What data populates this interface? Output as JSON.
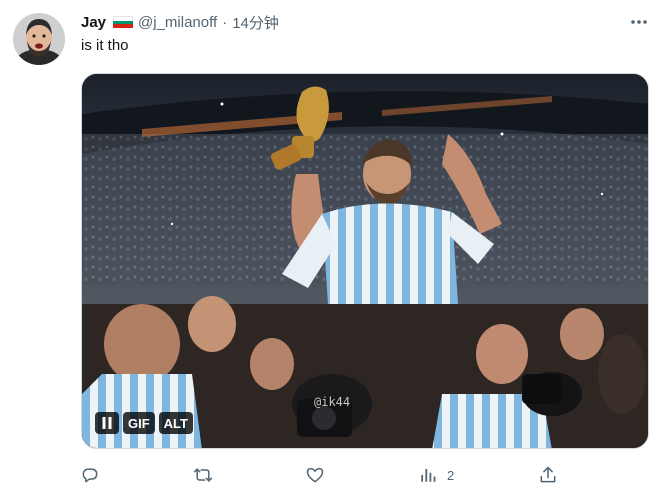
{
  "tweet": {
    "display_name": "Jay",
    "handle": "@j_milanoff",
    "separator": "·",
    "time": "14分钟",
    "text": "is it tho"
  },
  "media": {
    "watermark": "@ik44",
    "gif_badge": "GIF",
    "alt_badge": "ALT"
  },
  "actions": {
    "views_count": "2"
  },
  "icons": {
    "more": "more-icon",
    "reply": "reply-icon",
    "retweet": "retweet-icon",
    "like": "heart-icon",
    "views": "views-icon",
    "share": "share-icon",
    "pause": "pause-icon"
  },
  "colors": {
    "text_primary": "#0f1419",
    "text_secondary": "#536471",
    "border": "#cfd9de",
    "flag_white": "#ffffff",
    "flag_green": "#00966e",
    "flag_red": "#d62612"
  }
}
